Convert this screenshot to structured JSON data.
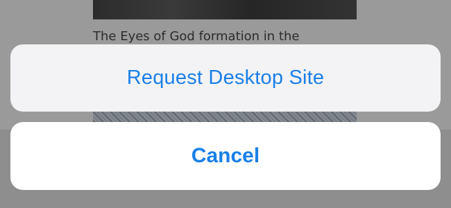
{
  "background_page": {
    "article_text": "The Eyes of God formation in the"
  },
  "action_sheet": {
    "request_desktop_label": "Request Desktop Site",
    "cancel_label": "Cancel",
    "accent_color": "#1a7fe8"
  }
}
